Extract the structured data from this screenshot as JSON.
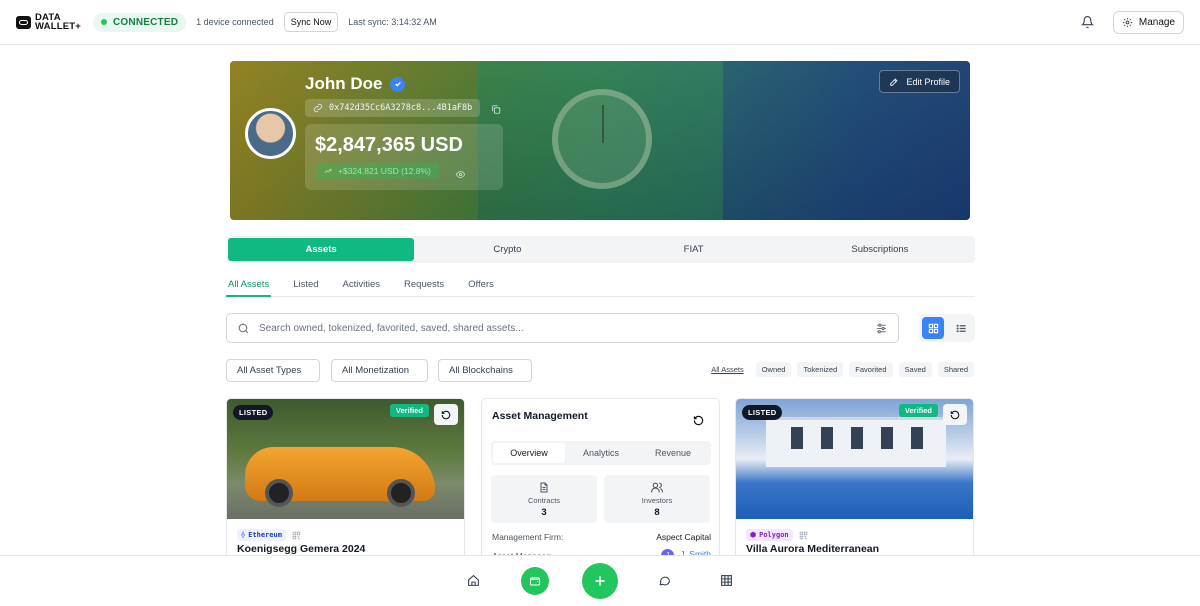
{
  "topbar": {
    "logo_line1": "DATA",
    "logo_line2": "WALLET+",
    "status": "CONNECTED",
    "devices": "1 device connected",
    "sync_button": "Sync Now",
    "last_sync": "Last sync: 3:14:32 AM",
    "manage_label": "Manage"
  },
  "profile": {
    "name": "John Doe",
    "wallet_address": "0x742d35Cc6A3278c8...4B1aF8b",
    "balance": "$2,847,365 USD",
    "change": "+$324,821 USD (12.8%)",
    "edit_label": "Edit Profile"
  },
  "main_tabs": [
    {
      "label": "Assets",
      "active": true
    },
    {
      "label": "Crypto",
      "active": false
    },
    {
      "label": "FIAT",
      "active": false
    },
    {
      "label": "Subscriptions",
      "active": false
    }
  ],
  "sub_tabs": [
    {
      "label": "All Assets",
      "active": true
    },
    {
      "label": "Listed",
      "active": false
    },
    {
      "label": "Activities",
      "active": false
    },
    {
      "label": "Requests",
      "active": false
    },
    {
      "label": "Offers",
      "active": false
    }
  ],
  "search": {
    "placeholder": "Search owned, tokenized, favorited, saved, shared assets..."
  },
  "filters": {
    "asset_types": "All Asset Types",
    "monetization": "All Monetization",
    "blockchains": "All Blockchains",
    "chips": [
      "All Assets",
      "Owned",
      "Tokenized",
      "Favorited",
      "Saved",
      "Shared"
    ]
  },
  "cards": [
    {
      "listed": "LISTED",
      "verified": "Verified",
      "chain": "Ethereum",
      "title": "Koenigsegg Gemera 2024"
    },
    {
      "listed": "LISTED",
      "verified": "Verified",
      "chain": "Polygon",
      "title": "Villa Aurora Mediterranean"
    }
  ],
  "management": {
    "title": "Asset Management",
    "tabs": [
      "Overview",
      "Analytics",
      "Revenue"
    ],
    "stats": [
      {
        "label": "Contracts",
        "value": "3"
      },
      {
        "label": "Investors",
        "value": "8"
      }
    ],
    "firm_label": "Management Firm:",
    "firm_value": "Aspect Capital",
    "manager_label": "Asset Manager:",
    "manager_initial": "J",
    "manager_name": "J. Smith"
  },
  "colors": {
    "accent": "#10b981",
    "blue": "#3b82f6"
  }
}
